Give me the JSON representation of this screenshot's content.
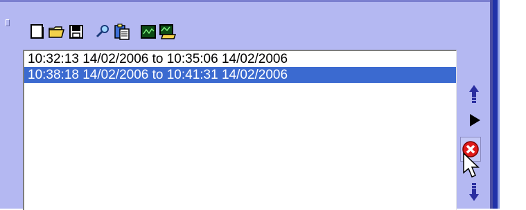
{
  "toolbar": {
    "buttons": [
      {
        "icon": "new-document-icon"
      },
      {
        "icon": "open-folder-icon"
      },
      {
        "icon": "save-disk-icon"
      },
      {
        "icon": "search-magnifier-icon"
      },
      {
        "icon": "paste-clipboard-icon"
      },
      {
        "icon": "chart-display-icon"
      },
      {
        "icon": "chart-export-icon"
      }
    ]
  },
  "list": {
    "items": [
      {
        "label": "10:32:13 14/02/2006 to 10:35:06 14/02/2006",
        "selected": false
      },
      {
        "label": "10:38:18 14/02/2006 to 10:41:31 14/02/2006",
        "selected": true
      }
    ]
  },
  "side_buttons": [
    {
      "icon": "move-up-arrow-icon"
    },
    {
      "icon": "play-icon"
    },
    {
      "icon": "delete-icon"
    },
    {
      "icon": "move-down-arrow-icon"
    }
  ],
  "colors": {
    "panel": "#b4b8f2",
    "selection": "#3b6ad0",
    "frame": "#2032a8",
    "delete": "#e01a1a",
    "arrow": "#2a2ea0"
  }
}
